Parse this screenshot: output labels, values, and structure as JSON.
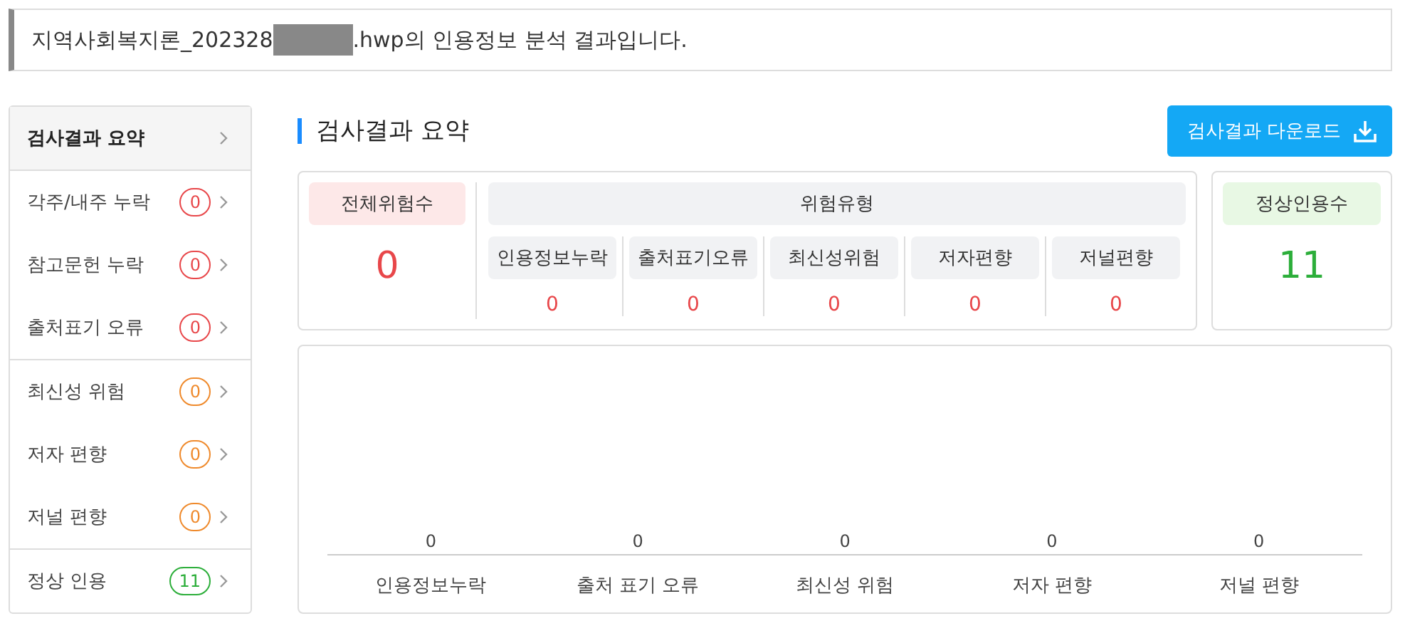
{
  "header": {
    "filename_start": "지역사회복지론_202328",
    "filename_end": ".hwp의 인용정보 분석 결과입니다."
  },
  "sidebar": {
    "groups": [
      {
        "items": [
          {
            "label": "검사결과 요약",
            "selected": true
          }
        ]
      },
      {
        "items": [
          {
            "label": "각주/내주 누락",
            "count": "0",
            "color": "#e8474a",
            "selected": false
          },
          {
            "label": "참고문헌 누락",
            "count": "0",
            "color": "#e8474a",
            "selected": false
          },
          {
            "label": "출처표기 오류",
            "count": "0",
            "color": "#e8474a",
            "selected": false
          }
        ]
      },
      {
        "items": [
          {
            "label": "최신성 위험",
            "count": "0",
            "color": "#ef8a2c",
            "selected": false
          },
          {
            "label": "저자 편향",
            "count": "0",
            "color": "#ef8a2c",
            "selected": false
          },
          {
            "label": "저널 편향",
            "count": "0",
            "color": "#ef8a2c",
            "selected": false
          }
        ]
      },
      {
        "items": [
          {
            "label": "정상 인용",
            "count": "11",
            "color": "#2cae3a",
            "selected": false
          }
        ]
      }
    ]
  },
  "main": {
    "title": "검사결과 요약",
    "download_button": "검사결과 다운로드",
    "total_risk": {
      "label": "전체위험수",
      "value": "0"
    },
    "risk_types": {
      "label": "위험유형",
      "types": [
        {
          "label": "인용정보누락",
          "value": "0"
        },
        {
          "label": "출처표기오류",
          "value": "0"
        },
        {
          "label": "최신성위험",
          "value": "0"
        },
        {
          "label": "저자편향",
          "value": "0"
        },
        {
          "label": "저널편향",
          "value": "0"
        }
      ]
    },
    "normal": {
      "label": "정상인용수",
      "value": "11"
    },
    "chart": {
      "items": [
        {
          "label": "인용정보누락",
          "value": "0"
        },
        {
          "label": "출처 표기 오류",
          "value": "0"
        },
        {
          "label": "최신성 위험",
          "value": "0"
        },
        {
          "label": "저자 편향",
          "value": "0"
        },
        {
          "label": "저널 편향",
          "value": "0"
        }
      ]
    }
  }
}
